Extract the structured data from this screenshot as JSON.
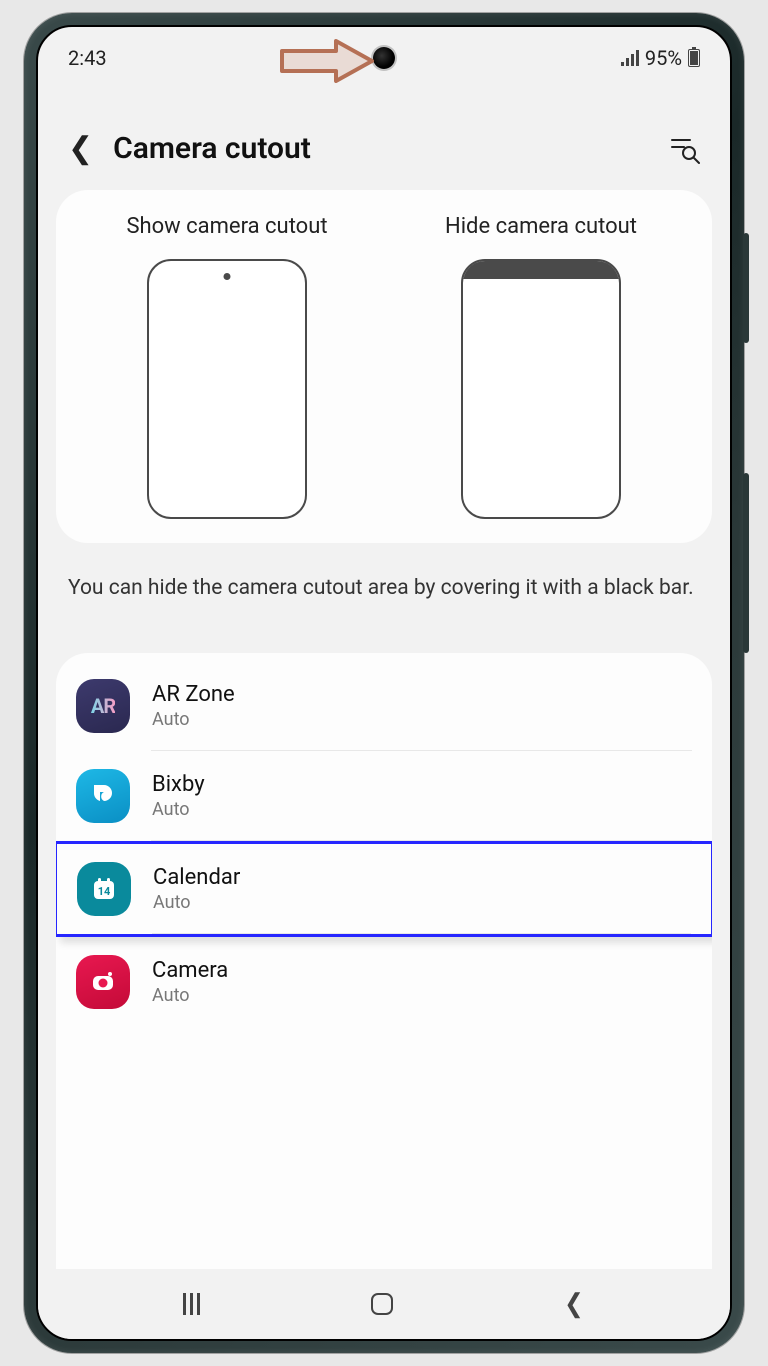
{
  "status": {
    "time": "2:43",
    "battery": "95%"
  },
  "header": {
    "title": "Camera cutout"
  },
  "options": {
    "show_label": "Show camera cutout",
    "hide_label": "Hide camera cutout"
  },
  "description": "You can hide the camera cutout area by covering it with a black bar.",
  "apps": [
    {
      "name": "AR Zone",
      "sub": "Auto",
      "icon": "ar"
    },
    {
      "name": "Bixby",
      "sub": "Auto",
      "icon": "bixby"
    },
    {
      "name": "Calendar",
      "sub": "Auto",
      "icon": "calendar",
      "highlighted": true
    },
    {
      "name": "Camera",
      "sub": "Auto",
      "icon": "camera"
    }
  ]
}
